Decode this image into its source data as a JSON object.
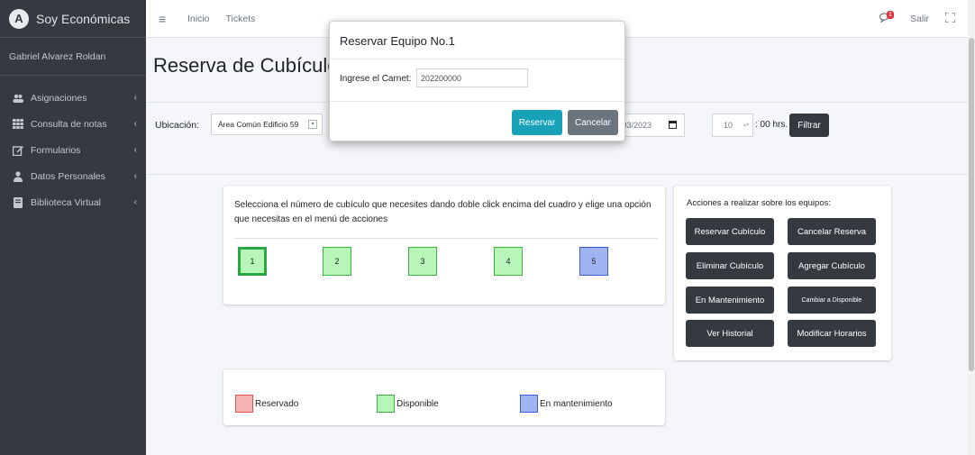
{
  "brand": {
    "name": "Soy Económicas"
  },
  "user": {
    "name": "Gabriel Alvarez Roldan"
  },
  "sidebar": {
    "items": [
      {
        "label": "Asignaciones"
      },
      {
        "label": "Consulta de notas"
      },
      {
        "label": "Formularios"
      },
      {
        "label": "Datos Personales"
      },
      {
        "label": "Biblioteca Virtual"
      }
    ]
  },
  "navbar": {
    "links": [
      "Inicio",
      "Tickets"
    ],
    "notif_count": "1",
    "logout_label": "Salir"
  },
  "page": {
    "title": "Reserva de Cubículos"
  },
  "filter": {
    "ubicacion_label": "Ubicación:",
    "ubicacion_value": "Área Común Edificio 59",
    "date_value": "/03/2023",
    "hour_value": "10",
    "hour_suffix": ": 00 hrs.",
    "filter_label": "Filtrar"
  },
  "cubicles": {
    "instructions": "Selecciona el número de cubículo que necesites dando doble click encima del cuadro y elige una opción que necesitas en el menú de acciones",
    "items": [
      {
        "number": "1",
        "status": "Disponible",
        "selected": true
      },
      {
        "number": "2",
        "status": "Disponible",
        "selected": false
      },
      {
        "number": "3",
        "status": "Disponible",
        "selected": false
      },
      {
        "number": "4",
        "status": "Disponible",
        "selected": false
      },
      {
        "number": "5",
        "status": "En mantenimiento",
        "selected": false
      }
    ]
  },
  "actions": {
    "title": "Acciones a realizar sobre los equipos:",
    "buttons": [
      "Reservar Cubículo",
      "Cancelar Reserva",
      "Eliminar Cubículo",
      "Agregar Cubículo",
      "En Mantenimiento",
      "Cambiar a Disponible",
      "Ver Historial",
      "Modificar Horarios"
    ]
  },
  "legend": {
    "items": [
      "Reservado",
      "Disponible",
      "En mantenimiento"
    ]
  },
  "modal": {
    "title": "Reservar Equipo No.1",
    "carnet_label": "Ingrese el Carnet:",
    "carnet_value": "202200000",
    "reserve_label": "Reservar",
    "cancel_label": "Cancelar"
  },
  "colors": {
    "sidebar_bg": "#343a40",
    "available": "#b7f5b9",
    "reserved": "#f5b2b2",
    "maintenance": "#9fb4f0",
    "primary_button": "#17a2b8",
    "secondary_button": "#6c757d"
  }
}
